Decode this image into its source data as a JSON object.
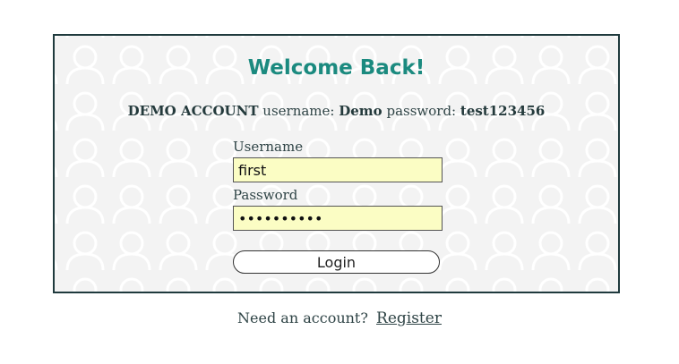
{
  "card": {
    "title": "Welcome Back!",
    "demo": {
      "heading": "DEMO ACCOUNT",
      "username_label": "username:",
      "username_value": "Demo",
      "password_label": "password:",
      "password_value": "test123456"
    }
  },
  "form": {
    "username_label": "Username",
    "username_value": "first",
    "password_label": "Password",
    "password_value": "••••••••••",
    "login_label": "Login"
  },
  "footer": {
    "prompt": "Need an account?",
    "register_link": "Register"
  },
  "colors": {
    "accent": "#1b8a7f",
    "input_bg": "#fbfdc4",
    "border": "#1f3a3d"
  }
}
